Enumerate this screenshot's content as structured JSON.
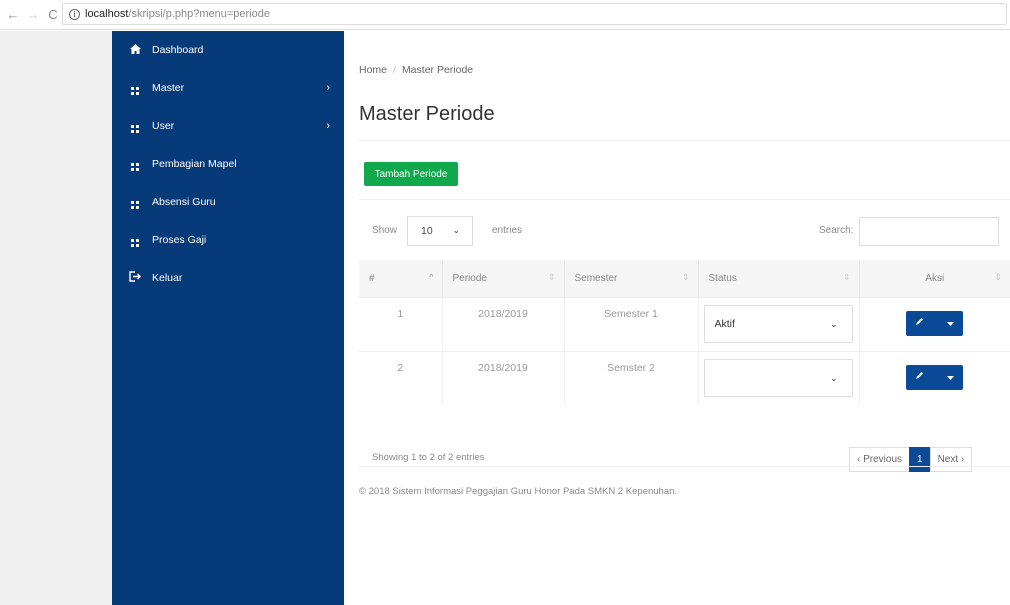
{
  "browser": {
    "back_glyph": "←",
    "forward_glyph": "→",
    "reload_glyph": "C",
    "url_host": "localhost",
    "url_path": "/skripsi/p.php?menu=periode"
  },
  "sidebar": {
    "items": [
      {
        "label": "Dashboard",
        "icon": "home-icon",
        "chevron": ""
      },
      {
        "label": "Master",
        "icon": "grid-icon",
        "chevron": "›"
      },
      {
        "label": "User",
        "icon": "grid-icon",
        "chevron": "›"
      },
      {
        "label": "Pembagian Mapel",
        "icon": "grid-icon",
        "chevron": ""
      },
      {
        "label": "Absensi Guru",
        "icon": "grid-icon",
        "chevron": ""
      },
      {
        "label": "Proses Gaji",
        "icon": "grid-icon",
        "chevron": ""
      },
      {
        "label": "Keluar",
        "icon": "logout-icon",
        "chevron": ""
      }
    ]
  },
  "breadcrumb": {
    "home": "Home",
    "separator": "/",
    "current": "Master Periode"
  },
  "page_title": "Master Periode",
  "add_button_label": "Tambah Periode",
  "table_controls": {
    "show_label": "Show",
    "page_length": "10",
    "entries_label": "entries",
    "search_label": "Search:",
    "search_value": ""
  },
  "table": {
    "headers": [
      "#",
      "Periode",
      "Semester",
      "Status",
      "Aksi"
    ],
    "rows": [
      {
        "no": "1",
        "periode": "2018/2019",
        "semester": "Semester 1",
        "status": "Aktif"
      },
      {
        "no": "2",
        "periode": "2018/2019",
        "semester": "Semster 2",
        "status": ""
      }
    ]
  },
  "info_text": "Showing 1 to 2 of 2 entries",
  "pagination": {
    "previous": "‹ Previous",
    "current": "1",
    "next": "Next ›"
  },
  "footer": "© 2018 Sistem Informasi Peggajian Guru Honor Pada SMKN 2 Kepenuhan.",
  "colors": {
    "sidebar_bg": "#073a78",
    "add_button": "#0fa84c",
    "action_button": "#0b4a96"
  }
}
